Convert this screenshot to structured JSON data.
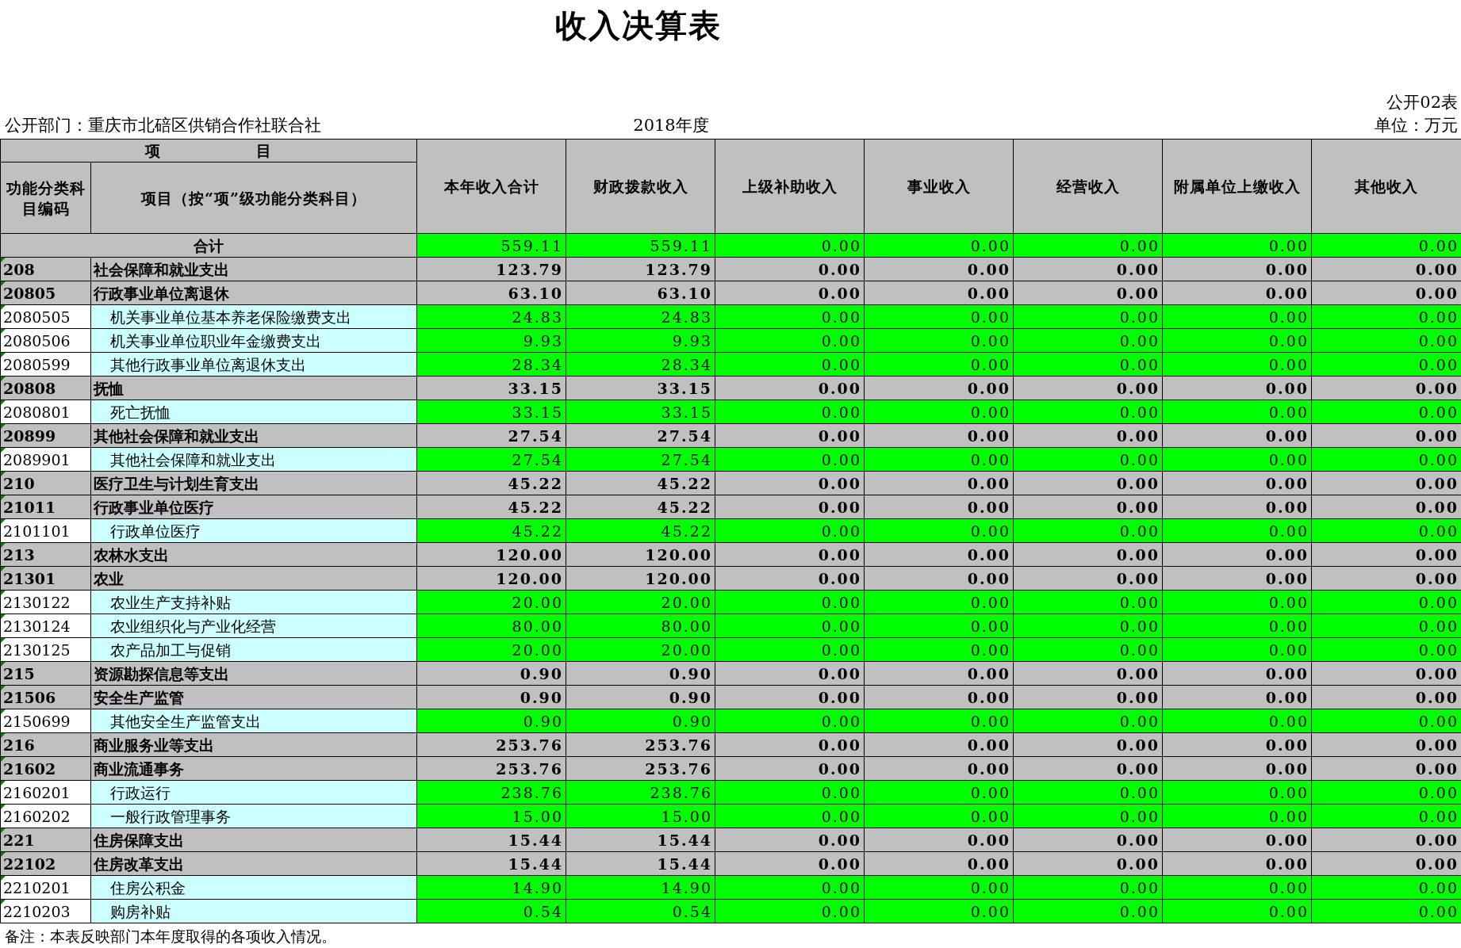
{
  "title": "收入决算表",
  "form_no": "公开02表",
  "department": "公开部门：重庆市北碚区供销合作社联合社",
  "year": "2018年度",
  "unit": "单位：万元",
  "header": {
    "group": "项　　　　　　目",
    "code": "功能分类科目编码",
    "name": "项目（按“项”级功能分类科目）",
    "columns": [
      "本年收入合计",
      "财政拨款收入",
      "上级补助收入",
      "事业收入",
      "经营收入",
      "附属单位上缴收入",
      "其他收入"
    ]
  },
  "total": {
    "label": "合计",
    "values": [
      "559.11",
      "559.11",
      "0.00",
      "0.00",
      "0.00",
      "0.00",
      "0.00"
    ]
  },
  "rows": [
    {
      "kind": "summary",
      "code": "208",
      "name": "社会保障和就业支出",
      "values": [
        "123.79",
        "123.79",
        "0.00",
        "0.00",
        "0.00",
        "0.00",
        "0.00"
      ]
    },
    {
      "kind": "summary",
      "code": "20805",
      "name": "行政事业单位离退休",
      "values": [
        "63.10",
        "63.10",
        "0.00",
        "0.00",
        "0.00",
        "0.00",
        "0.00"
      ]
    },
    {
      "kind": "detail",
      "code": "2080505",
      "name": "机关事业单位基本养老保险缴费支出",
      "values": [
        "24.83",
        "24.83",
        "0.00",
        "0.00",
        "0.00",
        "0.00",
        "0.00"
      ]
    },
    {
      "kind": "detail",
      "code": "2080506",
      "name": "机关事业单位职业年金缴费支出",
      "values": [
        "9.93",
        "9.93",
        "0.00",
        "0.00",
        "0.00",
        "0.00",
        "0.00"
      ]
    },
    {
      "kind": "detail",
      "code": "2080599",
      "name": "其他行政事业单位离退休支出",
      "values": [
        "28.34",
        "28.34",
        "0.00",
        "0.00",
        "0.00",
        "0.00",
        "0.00"
      ]
    },
    {
      "kind": "summary",
      "code": "20808",
      "name": "抚恤",
      "values": [
        "33.15",
        "33.15",
        "0.00",
        "0.00",
        "0.00",
        "0.00",
        "0.00"
      ]
    },
    {
      "kind": "detail",
      "code": "2080801",
      "name": "死亡抚恤",
      "values": [
        "33.15",
        "33.15",
        "0.00",
        "0.00",
        "0.00",
        "0.00",
        "0.00"
      ]
    },
    {
      "kind": "summary",
      "code": "20899",
      "name": "其他社会保障和就业支出",
      "values": [
        "27.54",
        "27.54",
        "0.00",
        "0.00",
        "0.00",
        "0.00",
        "0.00"
      ]
    },
    {
      "kind": "detail",
      "code": "2089901",
      "name": "其他社会保障和就业支出",
      "values": [
        "27.54",
        "27.54",
        "0.00",
        "0.00",
        "0.00",
        "0.00",
        "0.00"
      ]
    },
    {
      "kind": "summary",
      "code": "210",
      "name": "医疗卫生与计划生育支出",
      "values": [
        "45.22",
        "45.22",
        "0.00",
        "0.00",
        "0.00",
        "0.00",
        "0.00"
      ]
    },
    {
      "kind": "summary",
      "code": "21011",
      "name": "行政事业单位医疗",
      "values": [
        "45.22",
        "45.22",
        "0.00",
        "0.00",
        "0.00",
        "0.00",
        "0.00"
      ]
    },
    {
      "kind": "detail",
      "code": "2101101",
      "name": "行政单位医疗",
      "values": [
        "45.22",
        "45.22",
        "0.00",
        "0.00",
        "0.00",
        "0.00",
        "0.00"
      ]
    },
    {
      "kind": "summary",
      "code": "213",
      "name": "农林水支出",
      "values": [
        "120.00",
        "120.00",
        "0.00",
        "0.00",
        "0.00",
        "0.00",
        "0.00"
      ]
    },
    {
      "kind": "summary",
      "code": "21301",
      "name": "农业",
      "values": [
        "120.00",
        "120.00",
        "0.00",
        "0.00",
        "0.00",
        "0.00",
        "0.00"
      ]
    },
    {
      "kind": "detail",
      "code": "2130122",
      "name": "农业生产支持补贴",
      "values": [
        "20.00",
        "20.00",
        "0.00",
        "0.00",
        "0.00",
        "0.00",
        "0.00"
      ]
    },
    {
      "kind": "detail",
      "code": "2130124",
      "name": "农业组织化与产业化经营",
      "values": [
        "80.00",
        "80.00",
        "0.00",
        "0.00",
        "0.00",
        "0.00",
        "0.00"
      ]
    },
    {
      "kind": "detail",
      "code": "2130125",
      "name": "农产品加工与促销",
      "values": [
        "20.00",
        "20.00",
        "0.00",
        "0.00",
        "0.00",
        "0.00",
        "0.00"
      ]
    },
    {
      "kind": "summary",
      "code": "215",
      "name": "资源勘探信息等支出",
      "values": [
        "0.90",
        "0.90",
        "0.00",
        "0.00",
        "0.00",
        "0.00",
        "0.00"
      ]
    },
    {
      "kind": "summary",
      "code": "21506",
      "name": "安全生产监管",
      "values": [
        "0.90",
        "0.90",
        "0.00",
        "0.00",
        "0.00",
        "0.00",
        "0.00"
      ]
    },
    {
      "kind": "detail",
      "code": "2150699",
      "name": "其他安全生产监管支出",
      "values": [
        "0.90",
        "0.90",
        "0.00",
        "0.00",
        "0.00",
        "0.00",
        "0.00"
      ]
    },
    {
      "kind": "summary",
      "code": "216",
      "name": "商业服务业等支出",
      "values": [
        "253.76",
        "253.76",
        "0.00",
        "0.00",
        "0.00",
        "0.00",
        "0.00"
      ]
    },
    {
      "kind": "summary",
      "code": "21602",
      "name": "商业流通事务",
      "values": [
        "253.76",
        "253.76",
        "0.00",
        "0.00",
        "0.00",
        "0.00",
        "0.00"
      ]
    },
    {
      "kind": "detail",
      "code": "2160201",
      "name": "行政运行",
      "values": [
        "238.76",
        "238.76",
        "0.00",
        "0.00",
        "0.00",
        "0.00",
        "0.00"
      ]
    },
    {
      "kind": "detail",
      "code": "2160202",
      "name": "一般行政管理事务",
      "values": [
        "15.00",
        "15.00",
        "0.00",
        "0.00",
        "0.00",
        "0.00",
        "0.00"
      ]
    },
    {
      "kind": "summary",
      "code": "221",
      "name": "住房保障支出",
      "values": [
        "15.44",
        "15.44",
        "0.00",
        "0.00",
        "0.00",
        "0.00",
        "0.00"
      ]
    },
    {
      "kind": "summary",
      "code": "22102",
      "name": "住房改革支出",
      "values": [
        "15.44",
        "15.44",
        "0.00",
        "0.00",
        "0.00",
        "0.00",
        "0.00"
      ]
    },
    {
      "kind": "detail",
      "code": "2210201",
      "name": "住房公积金",
      "values": [
        "14.90",
        "14.90",
        "0.00",
        "0.00",
        "0.00",
        "0.00",
        "0.00"
      ]
    },
    {
      "kind": "detail",
      "code": "2210203",
      "name": "购房补贴",
      "values": [
        "0.54",
        "0.54",
        "0.00",
        "0.00",
        "0.00",
        "0.00",
        "0.00"
      ]
    }
  ],
  "note": "备注：本表反映部门本年度取得的各项收入情况。"
}
